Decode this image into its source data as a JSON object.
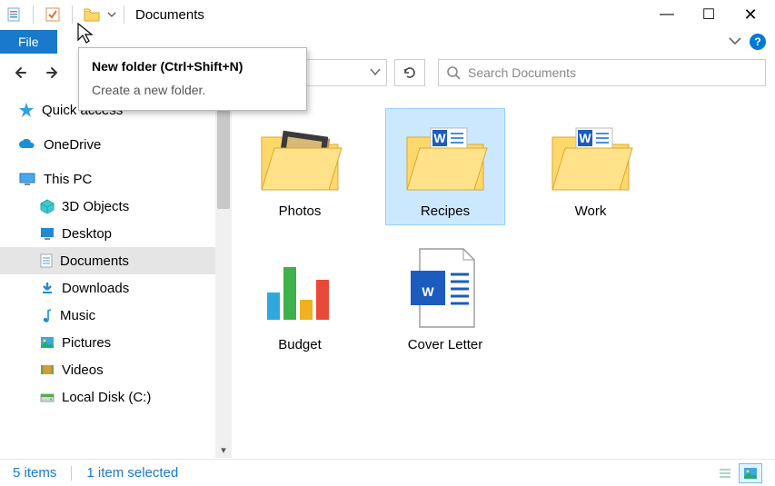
{
  "window": {
    "title": "Documents",
    "controls": {
      "min": "—",
      "max": "☐",
      "close": "✕"
    }
  },
  "ribbon": {
    "file_label": "File"
  },
  "tooltip": {
    "title": "New folder (Ctrl+Shift+N)",
    "desc": "Create a new folder."
  },
  "nav": {
    "search_placeholder": "Search Documents"
  },
  "sidebar": {
    "quick_access": "Quick access",
    "onedrive": "OneDrive",
    "this_pc": "This PC",
    "items": [
      {
        "label": "3D Objects"
      },
      {
        "label": "Desktop"
      },
      {
        "label": "Documents"
      },
      {
        "label": "Downloads"
      },
      {
        "label": "Music"
      },
      {
        "label": "Pictures"
      },
      {
        "label": "Videos"
      },
      {
        "label": "Local Disk (C:)"
      }
    ]
  },
  "content": {
    "items": [
      {
        "label": "Photos"
      },
      {
        "label": "Recipes"
      },
      {
        "label": "Work"
      },
      {
        "label": "Budget"
      },
      {
        "label": "Cover Letter"
      }
    ]
  },
  "status": {
    "count": "5 items",
    "selection": "1 item selected"
  }
}
